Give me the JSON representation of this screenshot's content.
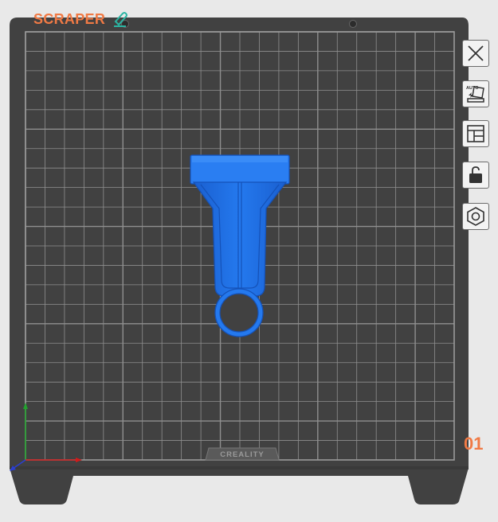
{
  "plate": {
    "title": "SCRAPER",
    "index": "01",
    "brand": "CREALITY"
  },
  "toolbar": {
    "items": [
      {
        "name": "close-plate",
        "icon": "close-icon"
      },
      {
        "name": "auto-arrange",
        "icon": "auto-orient-icon",
        "badge": "AUTO"
      },
      {
        "name": "arrange-layout",
        "icon": "layout-icon"
      },
      {
        "name": "lock-plate",
        "icon": "unlock-icon"
      },
      {
        "name": "plate-settings",
        "icon": "hex-nut-icon"
      }
    ]
  },
  "colors": {
    "background": "#e9e9e9",
    "bed": "#414141",
    "grid": "#8f8f8f",
    "model": "#1f6fe6",
    "accent": "#f07a45",
    "axis_x": "#d11b1b",
    "axis_y": "#22a22e",
    "axis_z": "#2b3fd0"
  }
}
